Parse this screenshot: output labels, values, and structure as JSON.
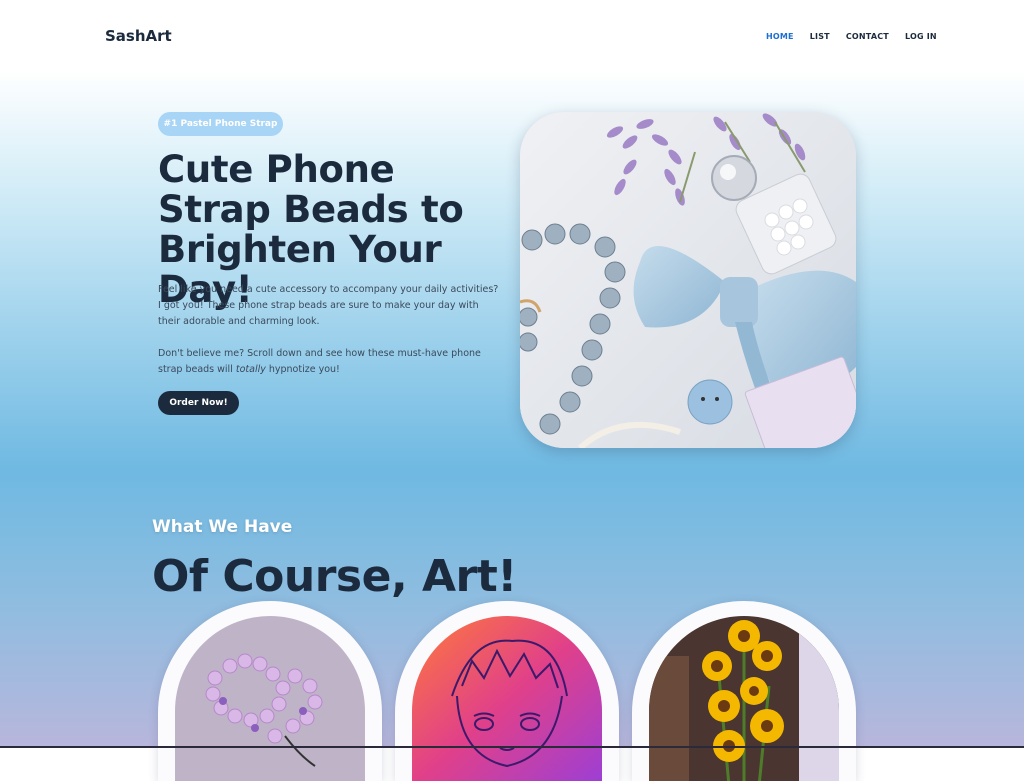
{
  "header": {
    "brand": "SashArt",
    "nav": [
      {
        "label": "HOME",
        "active": true
      },
      {
        "label": "LIST",
        "active": false
      },
      {
        "label": "CONTACT",
        "active": false
      },
      {
        "label": "LOG IN",
        "active": false
      }
    ]
  },
  "hero": {
    "badge": "#1 Pastel Phone Strap",
    "title": "Cute Phone Strap Beads to Brighten Your Day!",
    "paragraph1": "Feel like you need a cute accessory to accompany your daily activities? I got you! These phone strap beads are sure to make your day with their adorable and charming look.",
    "paragraph2_before": "Don't believe me? Scroll down and see how these must-have phone strap beads will ",
    "paragraph2_em": "totally",
    "paragraph2_after": " hypnotize you!",
    "cta": "Order Now!"
  },
  "section": {
    "subtitle": "What We Have",
    "title": "Of Course, Art!"
  },
  "colors": {
    "accent": "#1d6fd1",
    "dark": "#1b2a3d",
    "badge": "#a8d4f6"
  }
}
